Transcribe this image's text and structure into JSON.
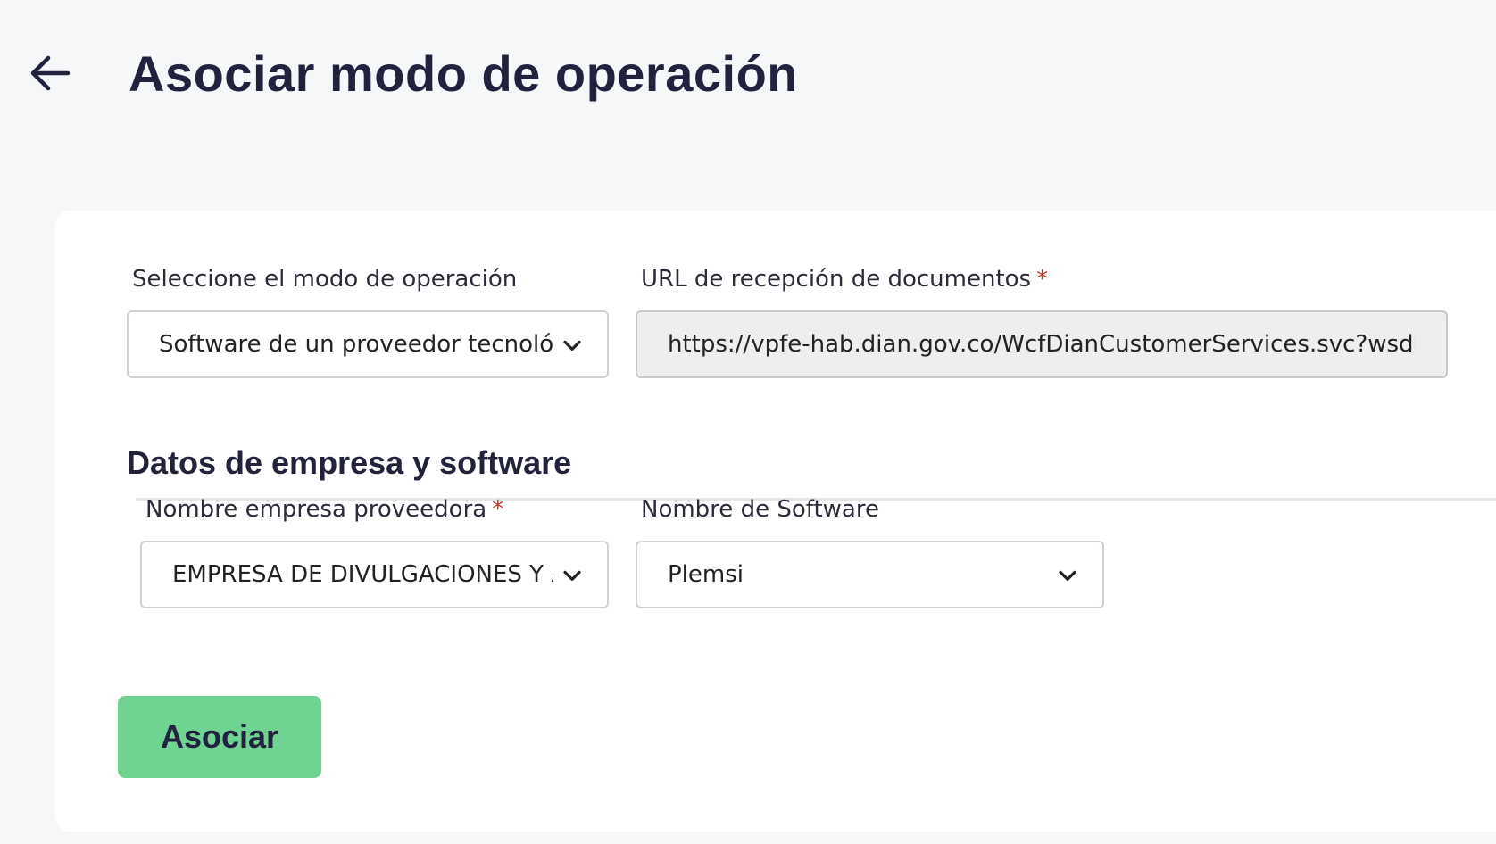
{
  "header": {
    "title": "Asociar modo de operación",
    "back_icon": "arrow-left-icon"
  },
  "form": {
    "operation_mode": {
      "label": "Seleccione el modo de operación",
      "value": "Software de un proveedor tecnológico"
    },
    "reception_url": {
      "label": "URL de recepción de documentos",
      "required_mark": "*",
      "value": "https://vpfe-hab.dian.gov.co/WcfDianCustomerServices.svc?wsdl"
    },
    "section": {
      "title": "Datos de empresa y software"
    },
    "provider_company": {
      "label": "Nombre empresa proveedora",
      "required_mark": "*",
      "value": "EMPRESA DE DIVULGACIONES Y ASESORÍAS"
    },
    "software_name": {
      "label": "Nombre de Software",
      "value": "Plemsi"
    },
    "submit_label": "Asociar"
  },
  "colors": {
    "background": "#f6f7f9",
    "card": "#ffffff",
    "accent_button": "#6fd492",
    "required": "#c0392b",
    "title_text": "#22223f"
  }
}
